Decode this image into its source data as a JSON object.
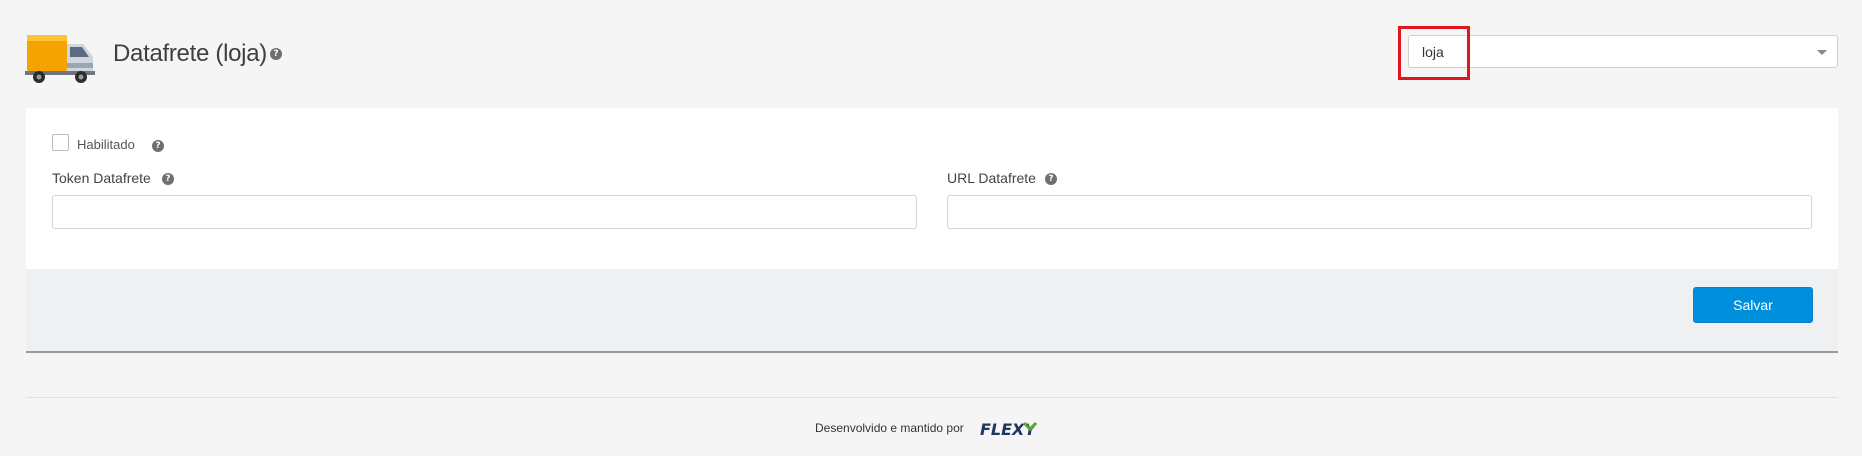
{
  "header": {
    "title": "Datafrete (loja)",
    "store_select": {
      "value": "loja"
    },
    "truck_icon": "truck-icon",
    "help_icon": "question-circle-icon"
  },
  "form": {
    "enabled_label": "Habilitado",
    "enabled_checked": false,
    "token_label": "Token Datafrete",
    "token_value": "",
    "url_label": "URL Datafrete",
    "url_value": "",
    "save_label": "Salvar"
  },
  "footer": {
    "credit_text": "Desenvolvido e mantido por",
    "brand": "FLEXY"
  },
  "colors": {
    "accent": "#008fdd",
    "highlight": "#e0161e",
    "brand_dark": "#1f3563",
    "brand_green": "#5aa731"
  }
}
